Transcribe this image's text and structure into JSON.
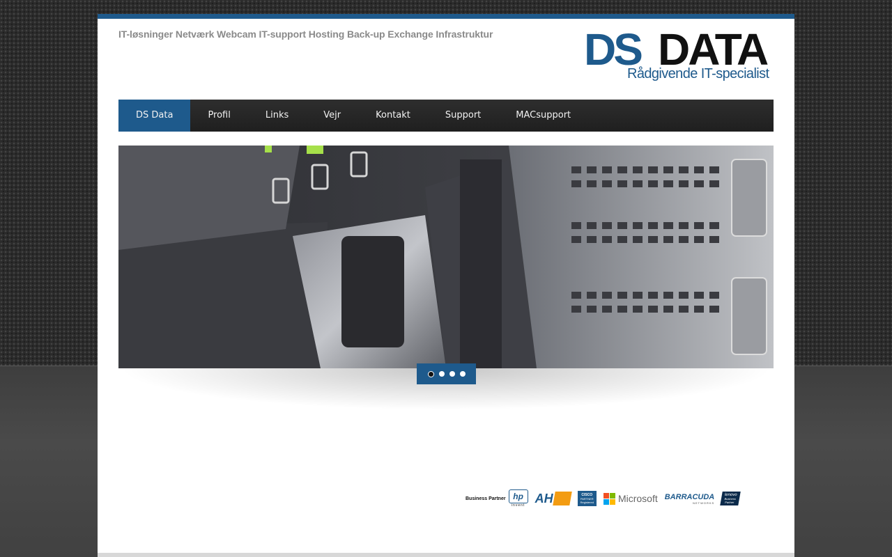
{
  "header": {
    "tagline": "IT-løsninger Netværk Webcam IT-support Hosting Back-up Exchange Infrastruktur",
    "logo": {
      "ds": "DS",
      "data": "DATA",
      "subtitle": "Rådgivende IT-specialist"
    }
  },
  "nav": {
    "items": [
      {
        "label": "DS Data",
        "active": true
      },
      {
        "label": "Profil"
      },
      {
        "label": "Links"
      },
      {
        "label": "Vejr"
      },
      {
        "label": "Kontakt"
      },
      {
        "label": "Support"
      },
      {
        "label": "MACsupport"
      }
    ]
  },
  "slider": {
    "image": "server-rack-photo",
    "dots_count": 4,
    "active_dot": 1
  },
  "partners": {
    "hp": {
      "label": "Business Partner",
      "logo": "hp",
      "sub": "invent"
    },
    "ahm": {
      "logo": "AH"
    },
    "cisco": {
      "logo": "CISCO",
      "sub1": "PARTNER",
      "sub2": "Registered"
    },
    "microsoft": {
      "logo": "Microsoft"
    },
    "barracuda": {
      "logo": "BARRACUDA",
      "sub": "NETWORKS"
    },
    "lenovo": {
      "logo": "lenovo",
      "sub1": "Business",
      "sub2": "Partner"
    }
  },
  "colors": {
    "accent": "#1e5a8c",
    "nav_bg": "#232323",
    "tagline": "#8a8a8a"
  }
}
